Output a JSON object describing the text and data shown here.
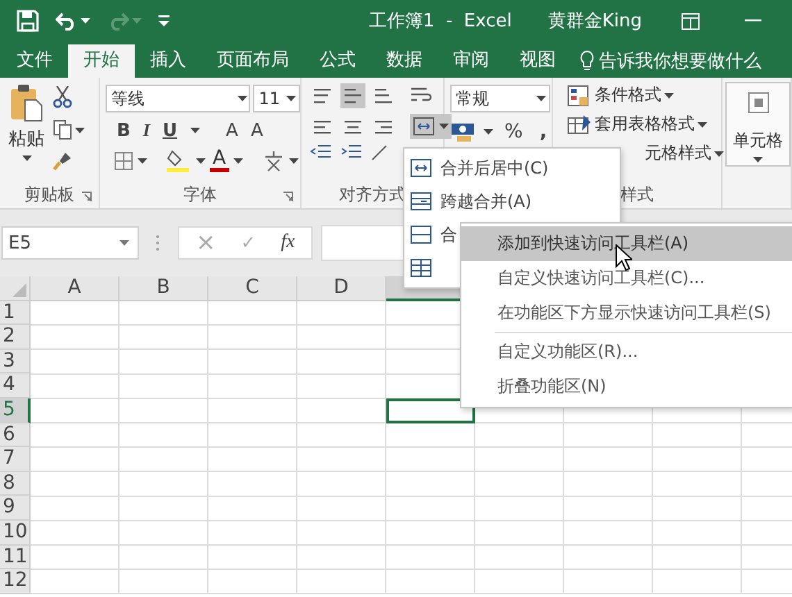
{
  "window": {
    "title": "工作簿1  -  Excel",
    "user": "黄群金King"
  },
  "quick_access": [
    {
      "kind": "save",
      "disabled": false
    },
    {
      "kind": "undo",
      "disabled": false
    },
    {
      "kind": "redo",
      "disabled": true
    },
    {
      "kind": "customize",
      "disabled": false
    }
  ],
  "tabs": [
    {
      "label": "文件",
      "selected": false
    },
    {
      "label": "开始",
      "selected": true
    },
    {
      "label": "插入",
      "selected": false
    },
    {
      "label": "页面布局",
      "selected": false
    },
    {
      "label": "公式",
      "selected": false
    },
    {
      "label": "数据",
      "selected": false
    },
    {
      "label": "审阅",
      "selected": false
    },
    {
      "label": "视图",
      "selected": false
    }
  ],
  "tell_me": {
    "placeholder": "告诉我你想要做什么"
  },
  "ribbon": {
    "groups": [
      {
        "kind": "clipboard",
        "label": "剪贴板",
        "paste_label": "粘贴"
      },
      {
        "kind": "font",
        "label": "字体",
        "font_name": "等线",
        "font_size": "11",
        "style_buttons": [
          "B",
          "I",
          "U"
        ],
        "size_buttons": [
          "A",
          "A"
        ],
        "font_color_glyph": "A"
      },
      {
        "kind": "alignment",
        "label": "对齐方式",
        "vertical_align": [
          {
            "selected": false
          },
          {
            "selected": true
          },
          {
            "selected": false
          }
        ],
        "merge_open": true
      },
      {
        "kind": "number",
        "format": "常规",
        "percent": "%",
        "comma": ","
      },
      {
        "kind": "styles",
        "label": "样式",
        "commands": [
          "条件格式",
          "套用表格格式",
          "元格样式"
        ]
      },
      {
        "kind": "cells",
        "label": "单元格"
      }
    ]
  },
  "formula_bar": {
    "name_box": "E5",
    "cancel": "×",
    "enter": "✓",
    "function_label": "fx"
  },
  "grid": {
    "columns": [
      {
        "label": "A",
        "selected": false
      },
      {
        "label": "B",
        "selected": false
      },
      {
        "label": "C",
        "selected": false
      },
      {
        "label": "D",
        "selected": false
      },
      {
        "selected": true
      }
    ],
    "rows": [
      {
        "label": "1",
        "selected": false
      },
      {
        "label": "2",
        "selected": false
      },
      {
        "label": "3",
        "selected": false
      },
      {
        "label": "4",
        "selected": false
      },
      {
        "label": "5",
        "selected": true
      },
      {
        "label": "6",
        "selected": false
      },
      {
        "label": "7",
        "selected": false
      },
      {
        "label": "8",
        "selected": false
      },
      {
        "label": "9",
        "selected": false
      },
      {
        "label": "10",
        "selected": false
      },
      {
        "label": "11",
        "selected": false
      },
      {
        "label": "12",
        "selected": false
      }
    ]
  },
  "merge_menu": {
    "items": [
      {
        "kind": "merge_center",
        "label": "合并后居中(C)"
      },
      {
        "kind": "merge_across",
        "label": "跨越合并(A)"
      },
      {
        "kind": "merge_cells",
        "label": "合"
      },
      {
        "kind": "unmerge"
      }
    ]
  },
  "context_menu": {
    "items": [
      {
        "label": "添加到快速访问工具栏(A)",
        "highlighted": true,
        "separator_after": false
      },
      {
        "label": "自定义快速访问工具栏(C)...",
        "highlighted": false,
        "separator_after": false
      },
      {
        "label": "在功能区下方显示快速访问工具栏(S)",
        "highlighted": false,
        "separator_after": true
      },
      {
        "label": "自定义功能区(R)...",
        "highlighted": false,
        "separator_after": false
      },
      {
        "label": "折叠功能区(N)",
        "highlighted": false,
        "separator_after": false
      }
    ]
  }
}
